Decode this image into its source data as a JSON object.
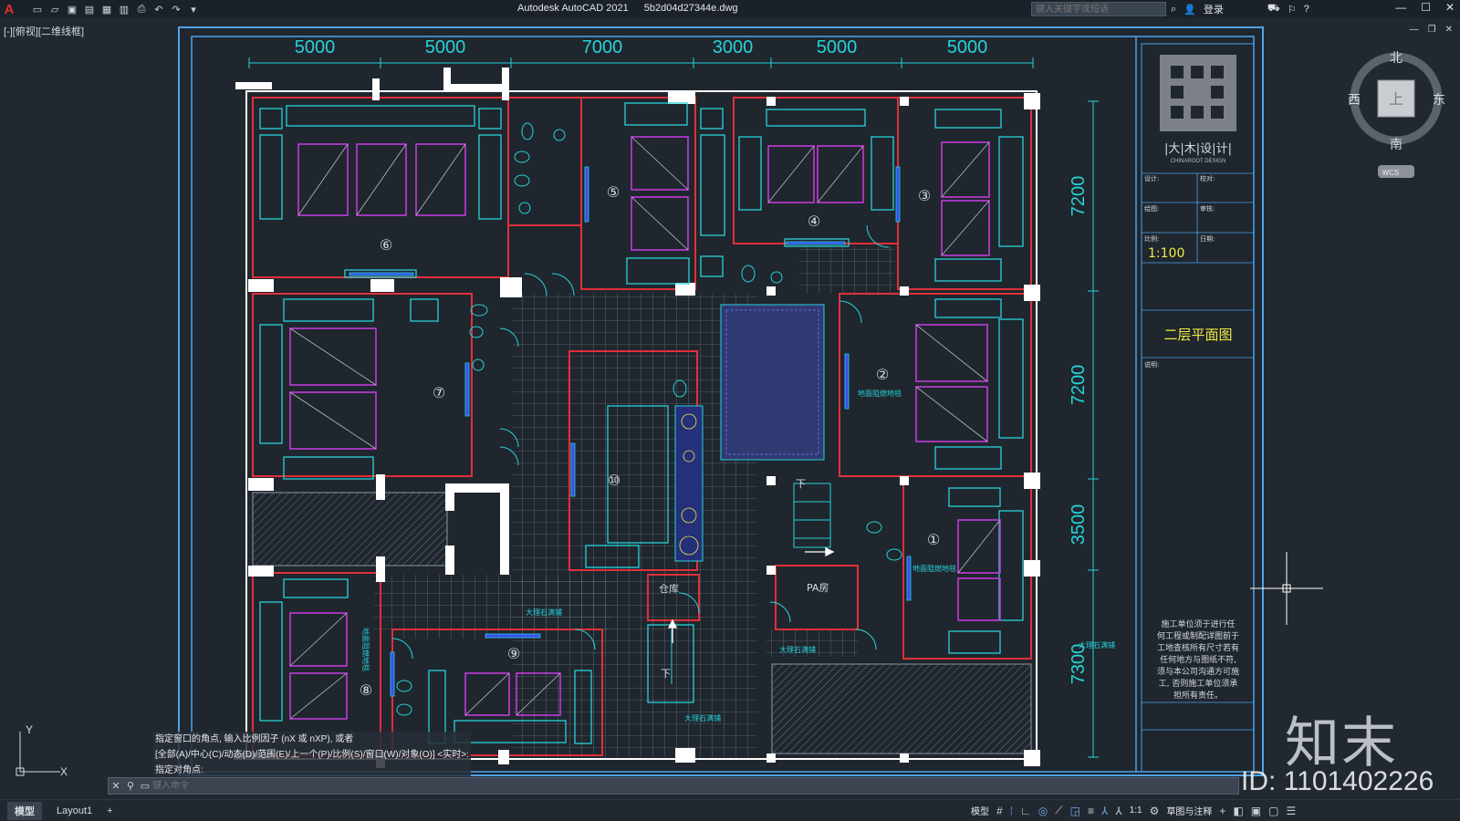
{
  "titlebar": {
    "app_name": "Autodesk AutoCAD 2021",
    "file_name": "5b2d04d27344e.dwg",
    "search_placeholder": "键入关键字或短语",
    "login_label": "登录"
  },
  "viewport": {
    "label": "[-][俯视][二维线框]"
  },
  "drawing": {
    "dimensions_top": [
      "5000",
      "5000",
      "7000",
      "3000",
      "5000",
      "5000"
    ],
    "dimensions_right": [
      "7200",
      "7200",
      "3500",
      "7300"
    ],
    "room_numbers": [
      "⑥",
      "⑤",
      "④",
      "③",
      "⑦",
      "②",
      "⑩",
      "①",
      "⑧",
      "⑨"
    ],
    "labels": {
      "storage": "仓库",
      "pa_room": "PA房",
      "down_1": "下",
      "down_2": "下",
      "marble_1": "大理石满铺",
      "marble_2": "大理石满铺",
      "marble_3": "大理石满铺",
      "marble_4": "大理石满铺",
      "floor_1": "地面阻燃地毯",
      "floor_2": "地面阻燃地毯",
      "floor_3": "地面阻燃地毯"
    },
    "title_block": {
      "company_en": "CHINAROOT DESIGN",
      "company_cn": "|大|木|设|计|",
      "fields": [
        "设计:",
        "校对:",
        "绘图:",
        "审核:",
        "比例:",
        "日期:"
      ],
      "scale": "1:100",
      "drawing_title": "二层平面图",
      "notes_label": "说明:",
      "notes": [
        "施工单位须于进行任",
        "何工程或制配详图前于",
        "工地查核所有尺寸若有",
        "任何地方与图纸不符,",
        "须与本公司沟通方可施",
        "工, 否则施工单位须承",
        "担所有责任。"
      ]
    }
  },
  "viewcube": {
    "north": "北",
    "south": "南",
    "east": "东",
    "west": "西",
    "face": "上",
    "wcs": "WCS"
  },
  "ucs": {
    "x": "X",
    "y": "Y"
  },
  "command": {
    "history": [
      "指定窗口的角点, 输入比例因子 (nX 或 nXP), 或者",
      "[全部(A)/中心(C)/动态(D)/范围(E)/上一个(P)/比例(S)/窗口(W)/对象(O)] <实时>:",
      "指定对角点:"
    ],
    "placeholder": "键入命令"
  },
  "tabs": [
    "模型",
    "Layout1"
  ],
  "statusbar": {
    "model": "模型",
    "scale": "1:1",
    "annotation": "草图与注释"
  },
  "watermark": {
    "logo": "知末",
    "id": "ID: 1101402226"
  },
  "colors": {
    "cyan": "#27d3d8",
    "red": "#e0303a",
    "magenta": "#c13ad9",
    "blue": "#3a4ef0",
    "frame": "#4fa3ea",
    "yellow": "#f2ec44"
  }
}
